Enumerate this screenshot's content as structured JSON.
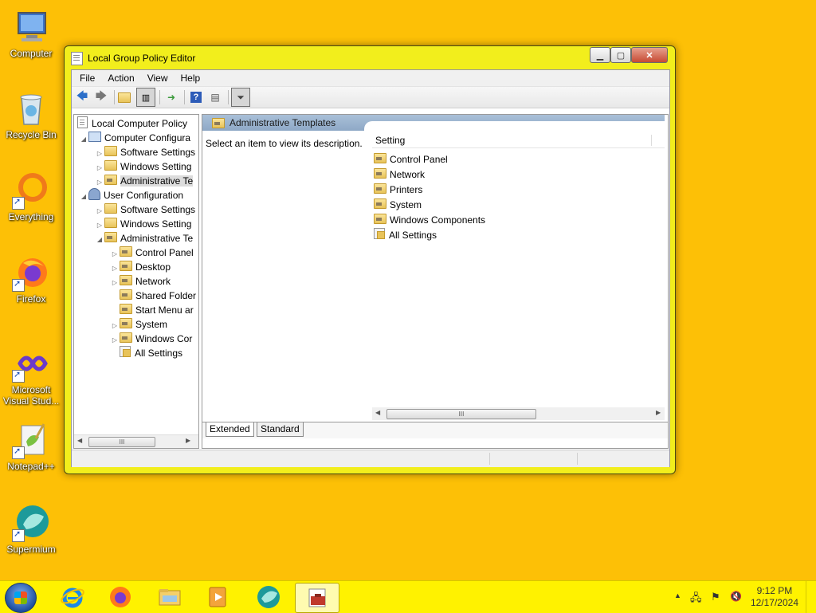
{
  "desktop": {
    "icons": [
      {
        "label": "Computer"
      },
      {
        "label": "Recycle Bin"
      },
      {
        "label": "Everything"
      },
      {
        "label": "Firefox"
      },
      {
        "label": "Microsoft Visual Stud..."
      },
      {
        "label": "Notepad++"
      },
      {
        "label": "Supermium"
      }
    ]
  },
  "window": {
    "title": "Local Group Policy Editor",
    "menu": [
      "File",
      "Action",
      "View",
      "Help"
    ],
    "tree": [
      {
        "label": "Local Computer Policy"
      },
      {
        "label": "Computer Configura"
      },
      {
        "label": "Software Settings"
      },
      {
        "label": "Windows Setting"
      },
      {
        "label": "Administrative Te"
      },
      {
        "label": "User Configuration"
      },
      {
        "label": "Software Settings"
      },
      {
        "label": "Windows Setting"
      },
      {
        "label": "Administrative Te"
      },
      {
        "label": "Control Panel"
      },
      {
        "label": "Desktop"
      },
      {
        "label": "Network"
      },
      {
        "label": "Shared Folder"
      },
      {
        "label": "Start Menu ar"
      },
      {
        "label": "System"
      },
      {
        "label": "Windows Cor"
      },
      {
        "label": "All Settings"
      }
    ],
    "right_header": "Administrative Templates",
    "description": "Select an item to view its description.",
    "column_header": "Setting",
    "items": [
      {
        "label": "Control Panel"
      },
      {
        "label": "Network"
      },
      {
        "label": "Printers"
      },
      {
        "label": "System"
      },
      {
        "label": "Windows Components"
      },
      {
        "label": "All Settings"
      }
    ],
    "tabs": [
      "Extended",
      "Standard"
    ],
    "scroll_thumb": "III"
  },
  "taskbar": {
    "time": "9:12 PM",
    "date": "12/17/2024"
  }
}
